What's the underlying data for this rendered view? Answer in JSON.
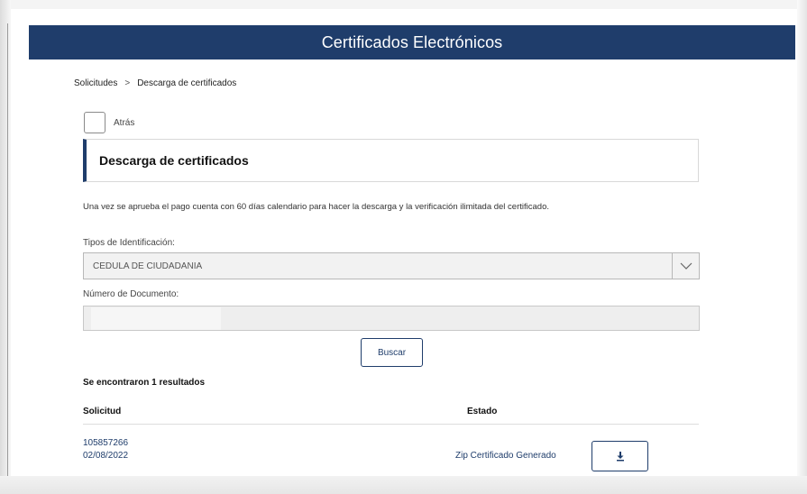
{
  "header": {
    "title": "Certificados Electrónicos"
  },
  "breadcrumb": {
    "items": [
      "Solicitudes",
      "Descarga de certificados"
    ],
    "separator": ">"
  },
  "back": {
    "label": "Atrás"
  },
  "section": {
    "title": "Descarga de certificados"
  },
  "info": {
    "text": "Una vez se aprueba el pago cuenta con 60 días calendario para hacer la descarga y la verificación ilimitada del certificado."
  },
  "form": {
    "tipo_label": "Tipos de Identificación:",
    "tipo_value": "CEDULA DE CIUDADANIA",
    "numero_label": "Número de Documento:",
    "numero_value": ""
  },
  "search": {
    "button_label": "Buscar"
  },
  "results": {
    "count_text": "Se encontraron 1 resultados",
    "columns": [
      "Solicitud",
      "Estado"
    ],
    "rows": [
      {
        "id": "105857266",
        "date": "02/08/2022",
        "status": "Zip Certificado Generado"
      }
    ]
  },
  "icons": {
    "dropdown": "chevron-down-icon",
    "download": "download-icon"
  },
  "colors": {
    "brand": "#1f3d6b",
    "header_text": "#ffffff",
    "input_bg": "#eeeeee"
  }
}
